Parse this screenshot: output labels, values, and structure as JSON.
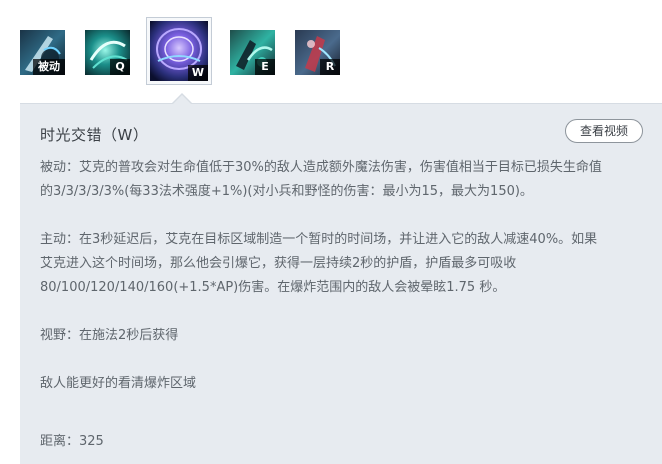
{
  "skills": [
    {
      "key_label": "被动"
    },
    {
      "key_label": "Q"
    },
    {
      "key_label": "W"
    },
    {
      "key_label": "E"
    },
    {
      "key_label": "R"
    }
  ],
  "detail": {
    "title": "时光交错（W）",
    "video_button": "查看视频",
    "passive_line1": "被动：艾克的普攻会对生命值低于30%的敌人造成额外魔法伤害，伤害值相当于目标已损失生命值",
    "passive_line2": "的3/3/3/3/3%(每33法术强度+1%)(对小兵和野怪的伤害：最小为15，最大为150)。",
    "active_line1": "主动：在3秒延迟后，艾克在目标区域制造一个暂时的时间场，并让进入它的敌人减速40%。如果",
    "active_line2": "艾克进入这个时间场，那么他会引爆它，获得一层持续2秒的护盾，护盾最多可吸收",
    "active_line3": "80/100/120/140/160(+1.5*AP)伤害。在爆炸范围内的敌人会被晕眩1.75 秒。",
    "vision": "视野：在施法2秒后获得",
    "enemy_note": "敌人能更好的看清爆炸区域",
    "range": "距离：325"
  },
  "colors": {
    "panel_bg": "#e7ebf0",
    "title_text": "#3a3f45",
    "body_text": "#5f666d",
    "button_border": "#8e959c"
  }
}
